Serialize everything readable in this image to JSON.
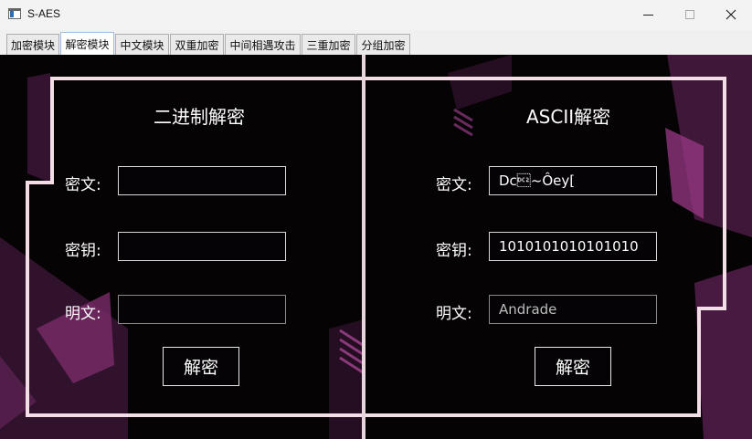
{
  "window": {
    "title": "S-AES"
  },
  "tabs": [
    {
      "label": "加密模块"
    },
    {
      "label": "解密模块"
    },
    {
      "label": "中文模块"
    },
    {
      "label": "双重加密"
    },
    {
      "label": "中间相遇攻击"
    },
    {
      "label": "三重加密"
    },
    {
      "label": "分组加密"
    }
  ],
  "binary": {
    "title": "二进制解密",
    "ciphertext_label": "密文:",
    "ciphertext_value": "",
    "key_label": "密钥:",
    "key_value": "",
    "plaintext_label": "明文:",
    "plaintext_value": "",
    "decrypt_label": "解密"
  },
  "ascii": {
    "title": "ASCII解密",
    "ciphertext_label": "密文:",
    "ciphertext_value": "Dc\u0012~Ôey[",
    "key_label": "密钥:",
    "key_value": "1010101010101010",
    "plaintext_label": "明文:",
    "plaintext_value": "Andrade",
    "decrypt_label": "解密"
  },
  "colors": {
    "accent": "#8e3a78",
    "frame": "#f3dde6",
    "background": "#060305"
  }
}
